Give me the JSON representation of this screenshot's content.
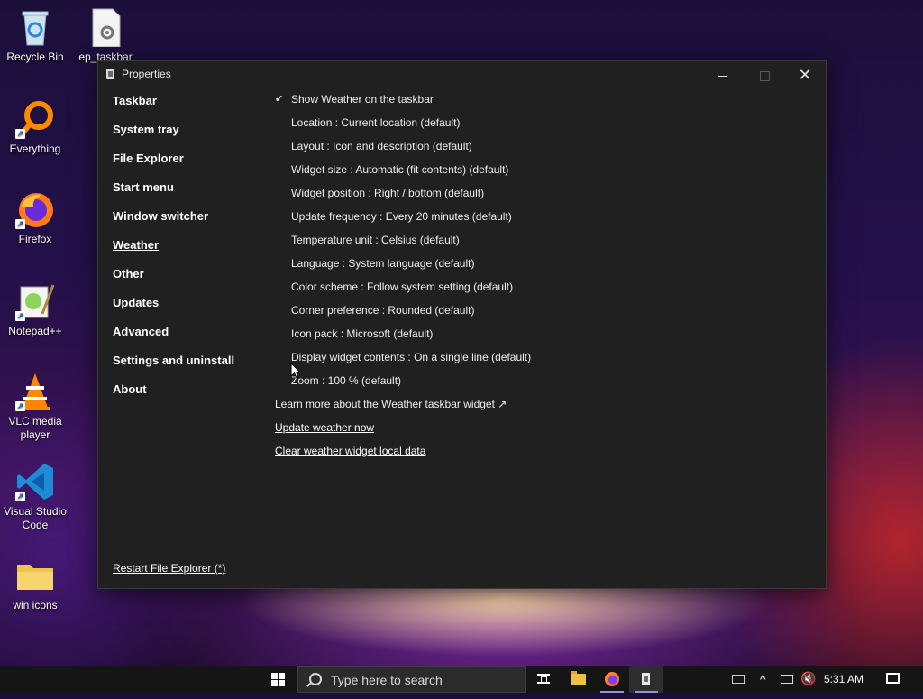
{
  "desktop": {
    "icons": [
      {
        "label": "Recycle Bin"
      },
      {
        "label": "ep_taskbar"
      },
      {
        "label": "Everything"
      },
      {
        "label": "Firefox"
      },
      {
        "label": "Notepad++"
      },
      {
        "label": "VLC media player"
      },
      {
        "label": "Visual Studio Code"
      },
      {
        "label": "win icons"
      }
    ]
  },
  "window": {
    "title": "Properties",
    "controls": {
      "minimize": "minimize",
      "maximize": "maximize",
      "close": "✕"
    }
  },
  "nav": {
    "items": [
      {
        "label": "Taskbar"
      },
      {
        "label": "System tray"
      },
      {
        "label": "File Explorer"
      },
      {
        "label": "Start menu"
      },
      {
        "label": "Window switcher"
      },
      {
        "label": "Weather",
        "active": true
      },
      {
        "label": "Other"
      },
      {
        "label": "Updates"
      },
      {
        "label": "Advanced"
      },
      {
        "label": "Settings and uninstall"
      },
      {
        "label": "About"
      }
    ],
    "restart_label": "Restart File Explorer (*)"
  },
  "weather": {
    "show_checkbox": {
      "checked": true,
      "check_glyph": "✔",
      "label": "Show Weather on the taskbar"
    },
    "options": [
      "Location : Current location (default)",
      "Layout : Icon and description (default)",
      "Widget size : Automatic (fit contents) (default)",
      "Widget position : Right / bottom (default)",
      "Update frequency : Every 20 minutes (default)",
      "Temperature unit : Celsius (default)",
      "Language : System language (default)",
      "Color scheme : Follow system setting (default)",
      "Corner preference : Rounded (default)",
      "Icon pack : Microsoft (default)",
      "Display widget contents : On a single line (default)",
      "Zoom : 100 % (default)"
    ],
    "learn_more": "Learn more about the Weather taskbar widget ↗",
    "update_now": "Update weather now",
    "clear_data": "Clear weather widget local data"
  },
  "taskbar": {
    "search_placeholder": "Type here to search",
    "time": "5:31 AM",
    "tray_up_glyph": "^",
    "volume_glyph": "🔇"
  }
}
